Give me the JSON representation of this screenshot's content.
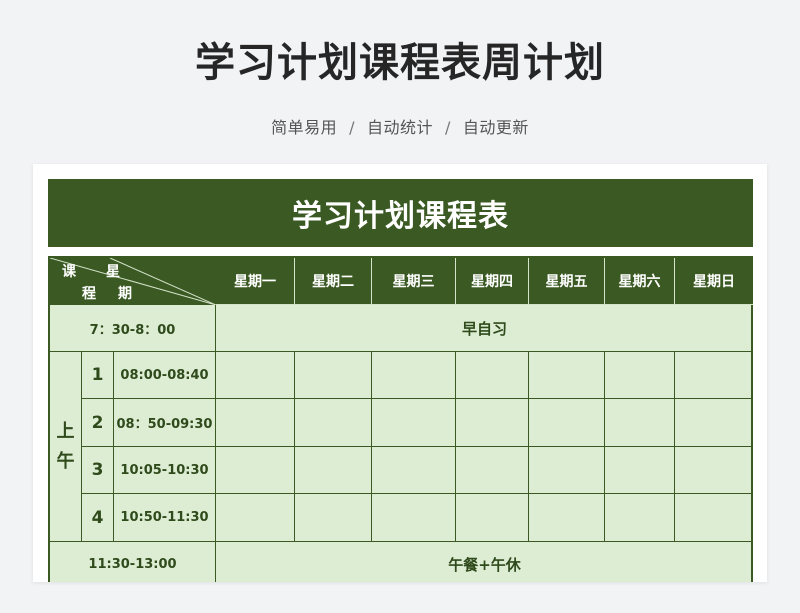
{
  "page": {
    "title": "学习计划课程表周计划",
    "tags": [
      "简单易用",
      "自动统计",
      "自动更新"
    ],
    "separator": "/"
  },
  "sheet": {
    "title": "学习计划课程表",
    "corner": {
      "ke": "课",
      "cheng": "程",
      "xing": "星",
      "qi": "期"
    },
    "days": [
      "星期一",
      "星期二",
      "星期三",
      "星期四",
      "星期五",
      "星期六",
      "星期日"
    ],
    "morning_reading": {
      "time": "7：30-8：00",
      "label": "早自习"
    },
    "am_label": {
      "first": "上",
      "second": "午"
    },
    "classes": [
      {
        "num": "1",
        "time": "08:00-08:40"
      },
      {
        "num": "2",
        "time": "08：50-09:30"
      },
      {
        "num": "3",
        "time": "10:05-10:30"
      },
      {
        "num": "4",
        "time": "10:50-11:30"
      }
    ],
    "lunch": {
      "time": "11:30-13:00",
      "label": "午餐+午休"
    }
  },
  "colors": {
    "header": "#3b5a23",
    "cell": "#dcedd3",
    "text": "#2f4a1b",
    "background": "#f2f3f5"
  }
}
